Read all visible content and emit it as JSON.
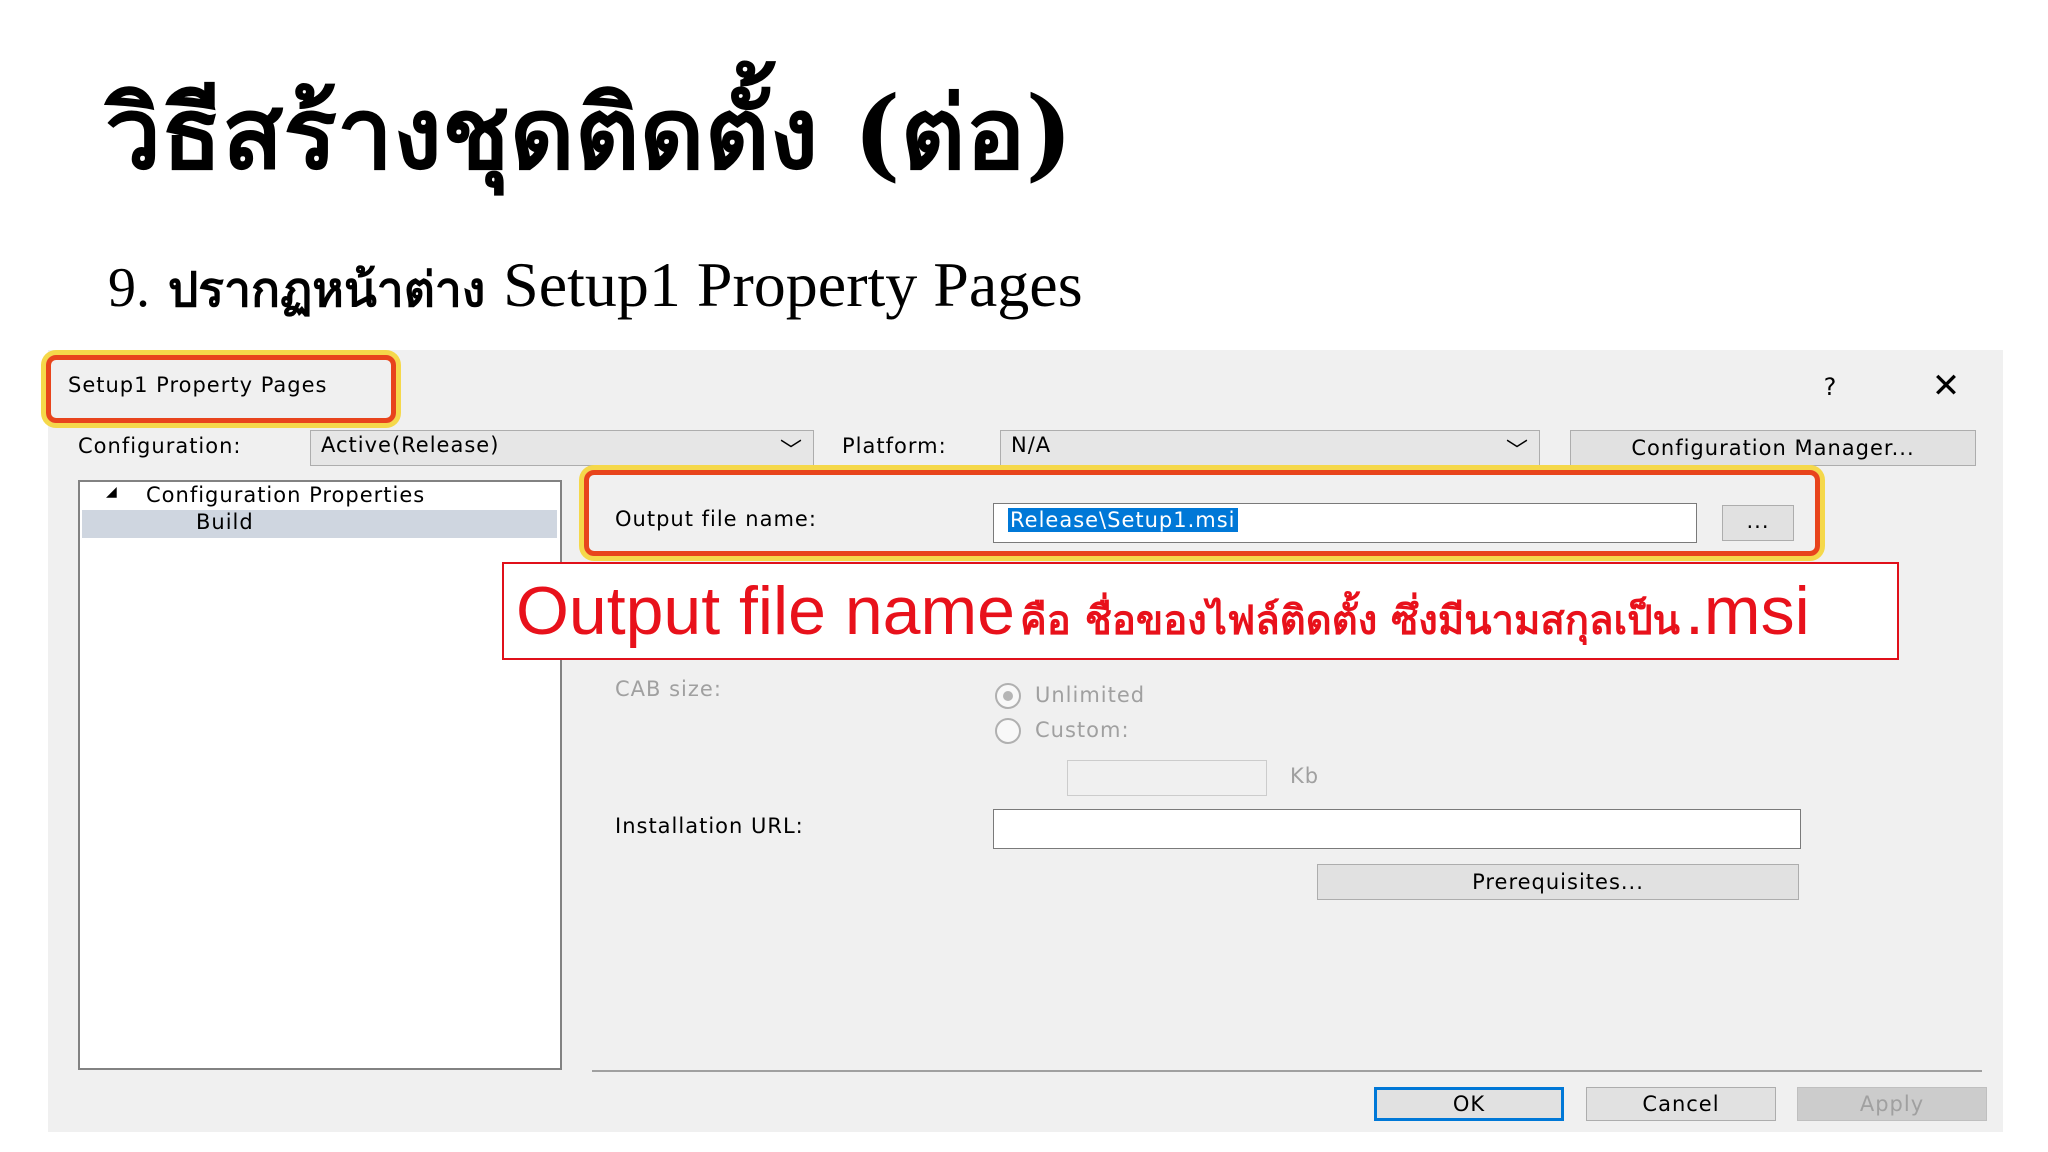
{
  "slide": {
    "title": "วิธีสร้างชุดติดตั้ง (ต่อ)",
    "subtitle_number": "9.",
    "subtitle_thai": "ปรากฏหน้าต่าง",
    "subtitle_english": "Setup1 Property Pages"
  },
  "dialog": {
    "title": "Setup1 Property Pages",
    "help_label": "?",
    "close_label": "✕",
    "configuration_label": "Configuration:",
    "configuration_value": "Active(Release)",
    "platform_label": "Platform:",
    "platform_value": "N/A",
    "config_manager_label": "Configuration Manager...",
    "tree": {
      "root_label": "Configuration Properties",
      "child_label": "Build",
      "expand_glyph": "◢"
    },
    "output_file_label": "Output file name:",
    "output_file_value": "Release\\Setup1.msi",
    "browse_label": "...",
    "cab_size_label": "CAB size:",
    "unlimited_label": "Unlimited",
    "custom_label": "Custom:",
    "kb_label": "Kb",
    "installation_url_label": "Installation URL:",
    "installation_url_value": "",
    "prerequisites_label": "Prerequisites...",
    "ok_label": "OK",
    "cancel_label": "Cancel",
    "apply_label": "Apply"
  },
  "callout": {
    "english_part": "Output file name",
    "thai_part": "คือ ชื่อของไฟล์ติดตั้ง ซึ่งมีนามสกุลเป็น",
    "extension_part": ".msi"
  },
  "colors": {
    "highlight_border": "#e8441c",
    "highlight_glow": "#f5d84a",
    "callout_text": "#e8111b",
    "selection": "#0078d7"
  }
}
